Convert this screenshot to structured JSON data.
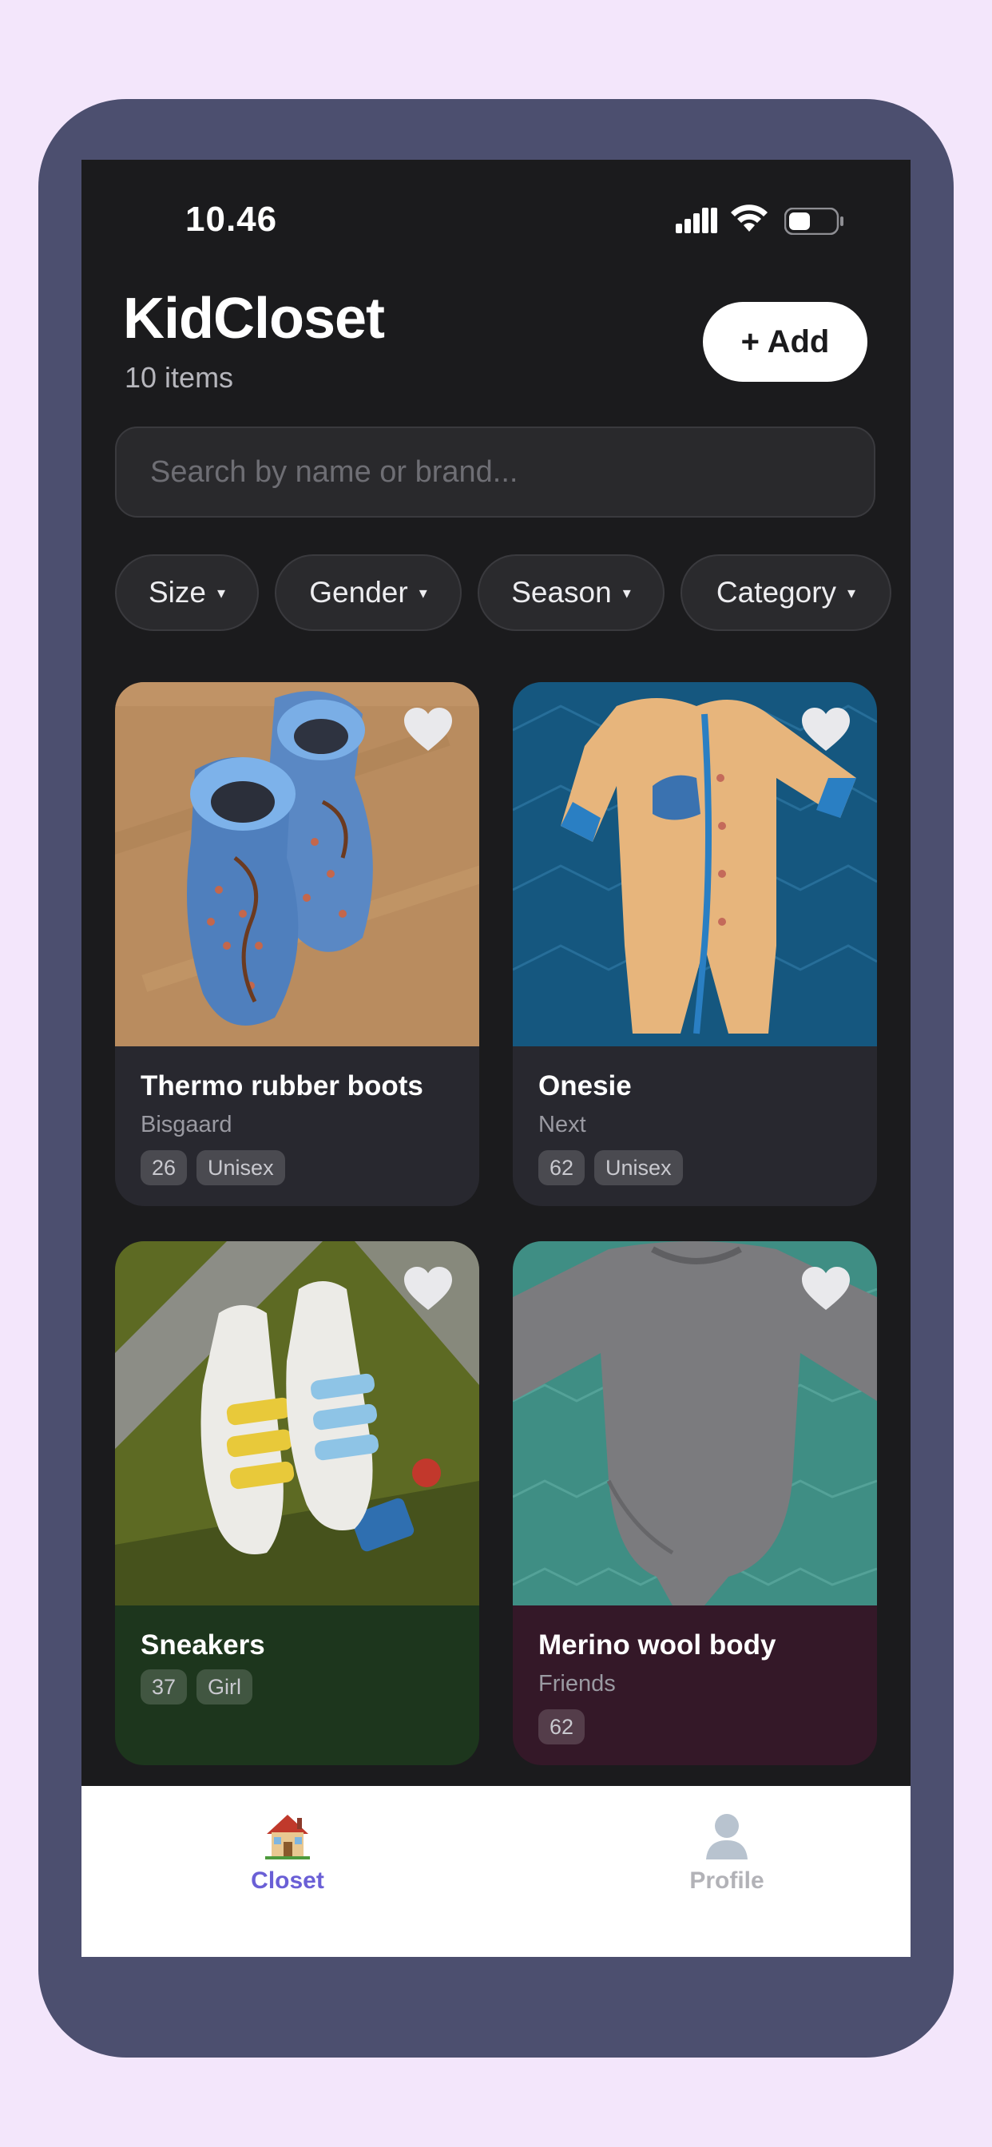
{
  "status_bar": {
    "time": "10.46"
  },
  "header": {
    "title": "KidCloset",
    "item_count": "10 items",
    "add_label": "+ Add"
  },
  "search": {
    "placeholder": "Search by name or brand..."
  },
  "filters": [
    {
      "label": "Size",
      "caret": "▾"
    },
    {
      "label": "Gender",
      "caret": "▾"
    },
    {
      "label": "Season",
      "caret": "▾"
    },
    {
      "label": "Category",
      "caret": "▾"
    }
  ],
  "items": [
    {
      "name": "Thermo rubber boots",
      "brand": "Bisgaard",
      "size": "26",
      "gender": "Unisex",
      "favorite_icon": "heart-icon",
      "card_color": "#28282f"
    },
    {
      "name": "Onesie",
      "brand": "Next",
      "size": "62",
      "gender": "Unisex",
      "favorite_icon": "heart-icon",
      "card_color": "#28282f"
    },
    {
      "name": "Sneakers",
      "size": "37",
      "gender": "Girl",
      "favorite_icon": "heart-icon",
      "card_color": "#1d361d"
    },
    {
      "name": "Merino wool body",
      "brand": "Friends",
      "size": "62",
      "favorite_icon": "heart-icon",
      "card_color": "#341828"
    }
  ],
  "tabbar": {
    "tabs": [
      {
        "label": "Closet",
        "icon": "house-icon",
        "active": true
      },
      {
        "label": "Profile",
        "icon": "person-icon",
        "active": false
      }
    ]
  },
  "colors": {
    "accent": "#6a5fd6",
    "inactive_tab": "#b2b2b7",
    "background": "#1b1b1d",
    "page_background": "#f3e6fb",
    "device_frame": "#4c4f6f"
  }
}
